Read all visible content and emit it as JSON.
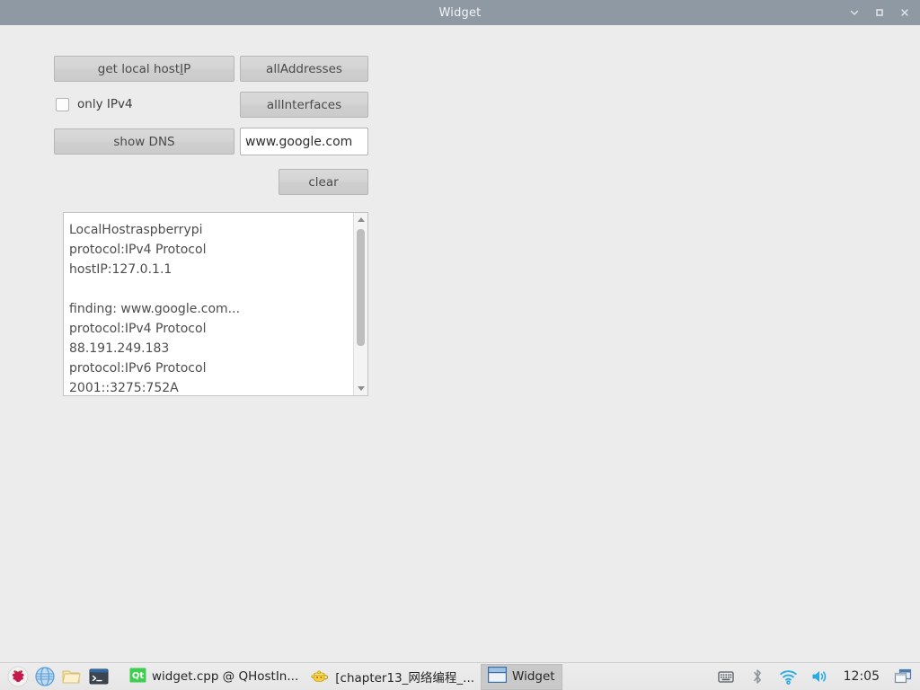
{
  "window": {
    "title": "Widget",
    "controls": {
      "minimize": "minimize",
      "maximize": "maximize",
      "close": "close"
    }
  },
  "form": {
    "get_local_hostip_label_pre": "get local host",
    "get_local_hostip_mnemonic": "I",
    "get_local_hostip_label_post": "P",
    "all_addresses_label": "allAddresses",
    "all_interfaces_label": "allInterfaces",
    "only_ipv4_label": "only IPv4",
    "only_ipv4_checked": false,
    "show_dns_label": "show DNS",
    "host_input_value": "www.google.com",
    "host_input_placeholder": "",
    "clear_label": "clear"
  },
  "output": {
    "lines": [
      "LocalHostraspberrypi",
      "protocol:IPv4 Protocol",
      "hostIP:127.0.1.1",
      "",
      "finding: www.google.com...",
      "protocol:IPv4 Protocol",
      "88.191.249.183",
      "protocol:IPv6 Protocol",
      "2001::3275:752A"
    ]
  },
  "taskbar": {
    "launchers": [
      {
        "name": "raspberry-menu-icon",
        "label": "Menu"
      },
      {
        "name": "web-browser-icon",
        "label": "Web Browser"
      },
      {
        "name": "file-manager-icon",
        "label": "File Manager"
      },
      {
        "name": "terminal-icon",
        "label": "Terminal"
      }
    ],
    "tasks": [
      {
        "name": "task-qt-creator",
        "icon": "qt-icon",
        "label": "widget.cpp @ QHostIn...",
        "active": false
      },
      {
        "name": "task-file-archive",
        "icon": "teapot-icon",
        "label": "[chapter13_网络编程_...",
        "active": false
      },
      {
        "name": "task-widget",
        "icon": "window-icon",
        "label": "Widget",
        "active": true
      }
    ],
    "tray": [
      {
        "name": "virtual-keyboard-icon"
      },
      {
        "name": "bluetooth-icon"
      },
      {
        "name": "wifi-icon"
      },
      {
        "name": "volume-icon"
      }
    ],
    "clock": "12:05",
    "show_desktop": "show-desktop"
  },
  "colors": {
    "titlebar": "#8e99a4",
    "window_bg": "#ececec",
    "button_face": "#d4d4d4",
    "taskbar_bg": "#e9e9e9",
    "accent_blue": "#29abe2",
    "qt_green": "#41cd52"
  }
}
